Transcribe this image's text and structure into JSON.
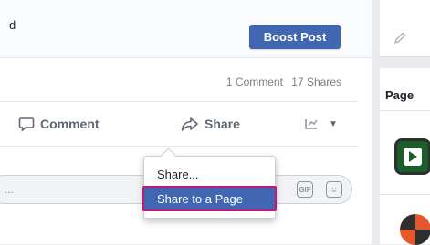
{
  "post": {
    "title_fragment": "d",
    "boost_button": "Boost Post",
    "comments_count": "1 Comment",
    "shares_count": "17 Shares"
  },
  "actions": {
    "comment": "Comment",
    "share": "Share"
  },
  "comment_box": {
    "placeholder": "..."
  },
  "share_menu": {
    "items": [
      "Share...",
      "Share to a Page"
    ],
    "highlighted": "Share to a Page"
  },
  "right_column": {
    "pages_label": "Page"
  },
  "colors": {
    "accent": "#4267b2",
    "highlight_border": "#c2187a"
  }
}
